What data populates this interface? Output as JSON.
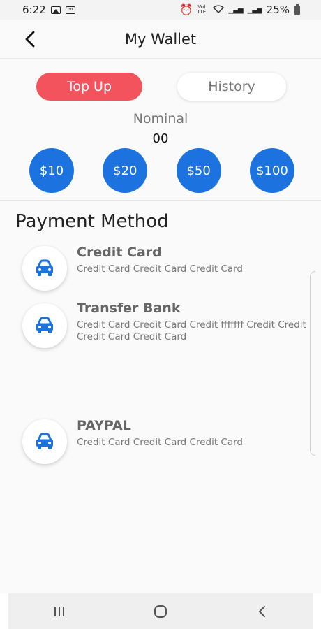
{
  "status_bar": {
    "time": "6:22",
    "battery": "25%",
    "volte": "Vo) LTE"
  },
  "header": {
    "title": "My Wallet"
  },
  "tabs": {
    "top_up": "Top Up",
    "history": "History"
  },
  "nominal": {
    "label": "Nominal",
    "value": "00"
  },
  "amounts": [
    "$10",
    "$20",
    "$50",
    "$100"
  ],
  "payment": {
    "title": "Payment Method",
    "methods": [
      {
        "name": "Credit Card",
        "desc": "Credit Card Credit Card Credit Card",
        "icon": "car-icon"
      },
      {
        "name": "Transfer Bank",
        "desc": "Credit Card Credit Card Credit fffffff Credit Credit Credit Card Credit Card",
        "icon": "car-icon"
      },
      {
        "name": "PAYPAL",
        "desc": "Credit Card Credit Card Credit Card",
        "icon": "car-icon"
      }
    ]
  },
  "colors": {
    "accent": "#f2535c",
    "primary": "#1c73e0"
  }
}
